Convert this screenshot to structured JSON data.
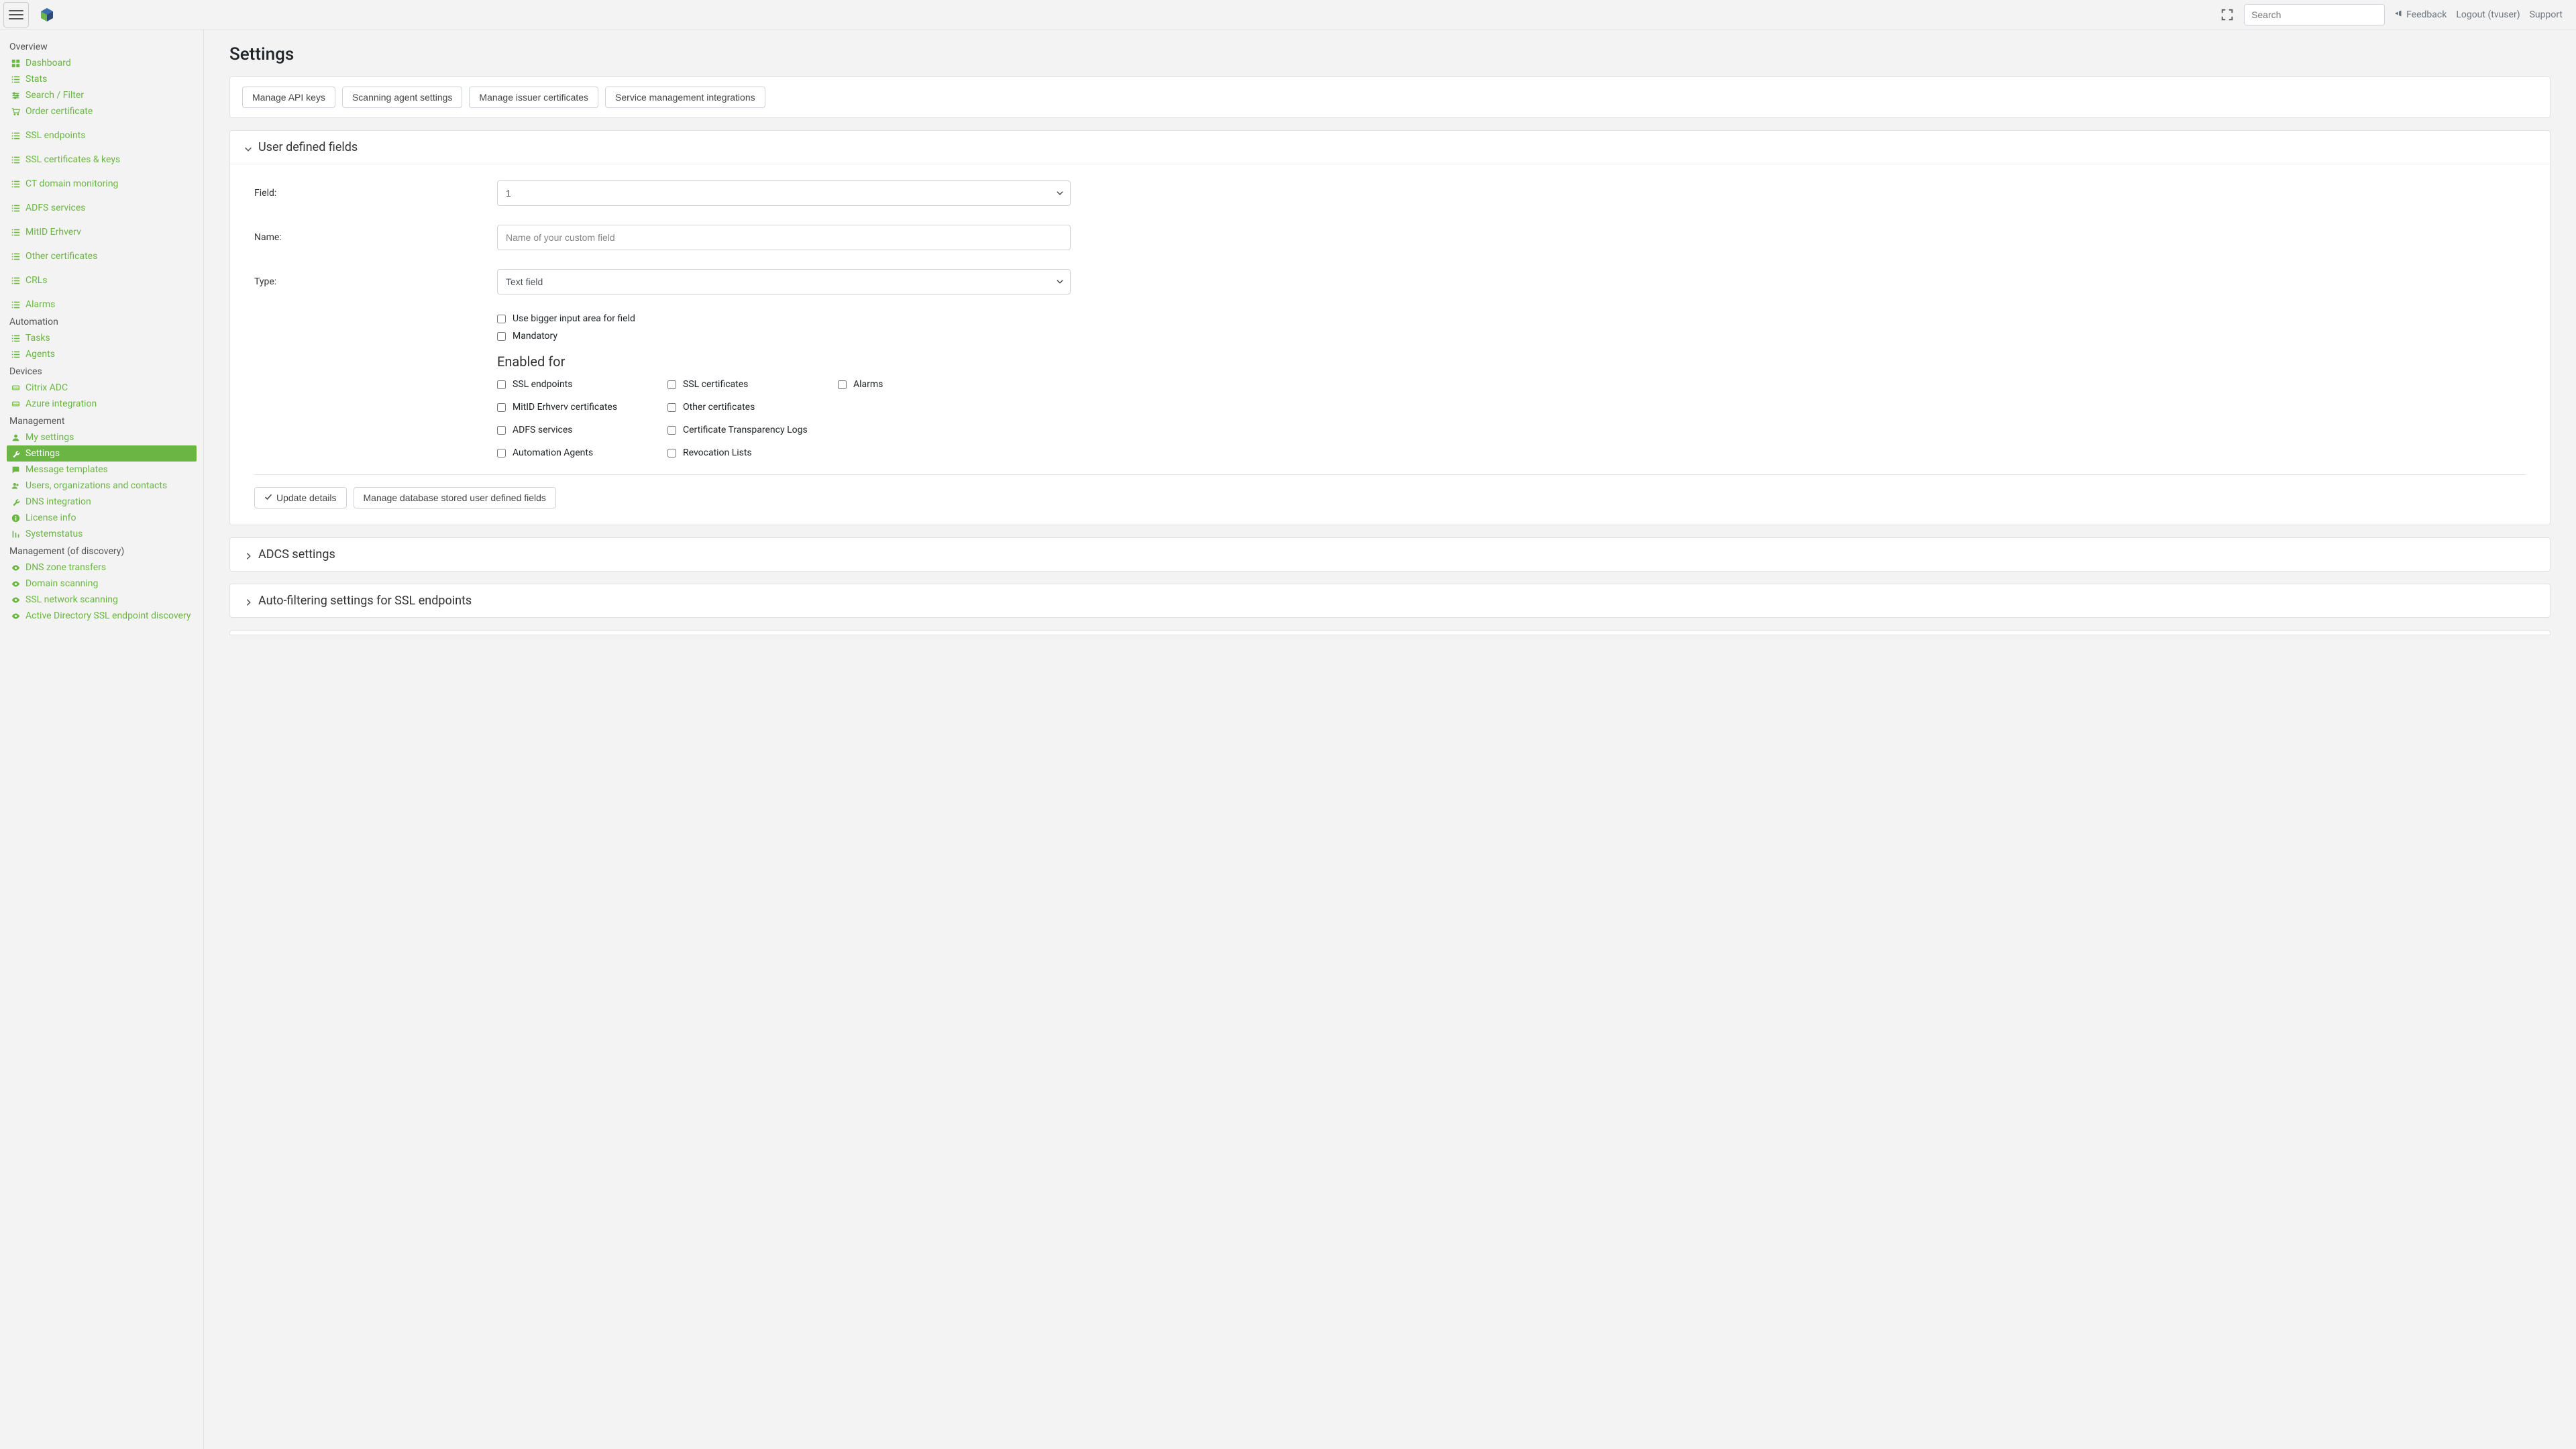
{
  "header": {
    "search_placeholder": "Search",
    "feedback_label": "Feedback",
    "logout_label": "Logout (tvuser)",
    "support_label": "Support"
  },
  "sidebar": {
    "sections": [
      {
        "heading": "Overview",
        "items": [
          {
            "icon": "grid",
            "label": "Dashboard"
          },
          {
            "icon": "list",
            "label": "Stats"
          },
          {
            "icon": "sliders",
            "label": "Search / Filter"
          },
          {
            "icon": "cart",
            "label": "Order certificate"
          }
        ]
      },
      {
        "heading": "",
        "items": [
          {
            "icon": "list",
            "label": "SSL endpoints"
          }
        ]
      },
      {
        "heading": "",
        "items": [
          {
            "icon": "list",
            "label": "SSL certificates & keys"
          }
        ]
      },
      {
        "heading": "",
        "items": [
          {
            "icon": "list",
            "label": "CT domain monitoring"
          }
        ]
      },
      {
        "heading": "",
        "items": [
          {
            "icon": "list",
            "label": "ADFS services"
          }
        ]
      },
      {
        "heading": "",
        "items": [
          {
            "icon": "list",
            "label": "MitID Erhverv"
          }
        ]
      },
      {
        "heading": "",
        "items": [
          {
            "icon": "list",
            "label": "Other certificates"
          }
        ]
      },
      {
        "heading": "",
        "items": [
          {
            "icon": "list",
            "label": "CRLs"
          }
        ]
      },
      {
        "heading": "",
        "items": [
          {
            "icon": "list",
            "label": "Alarms"
          }
        ]
      },
      {
        "heading": "Automation",
        "items": [
          {
            "icon": "list",
            "label": "Tasks"
          },
          {
            "icon": "list",
            "label": "Agents"
          }
        ]
      },
      {
        "heading": "Devices",
        "items": [
          {
            "icon": "device",
            "label": "Citrix ADC"
          },
          {
            "icon": "device",
            "label": "Azure integration"
          }
        ]
      },
      {
        "heading": "Management",
        "items": [
          {
            "icon": "user",
            "label": "My settings"
          },
          {
            "icon": "wrench",
            "label": "Settings",
            "active": true
          },
          {
            "icon": "message",
            "label": "Message templates"
          },
          {
            "icon": "users",
            "label": "Users, organizations and contacts"
          },
          {
            "icon": "wrench",
            "label": "DNS integration"
          },
          {
            "icon": "info",
            "label": "License info"
          },
          {
            "icon": "equalizer",
            "label": "Systemstatus"
          }
        ]
      },
      {
        "heading": "Management (of discovery)",
        "items": [
          {
            "icon": "eye",
            "label": "DNS zone transfers"
          },
          {
            "icon": "eye",
            "label": "Domain scanning"
          },
          {
            "icon": "eye",
            "label": "SSL network scanning"
          },
          {
            "icon": "eye",
            "label": "Active Directory SSL endpoint discovery"
          }
        ]
      }
    ]
  },
  "main": {
    "page_title": "Settings",
    "action_buttons": [
      "Manage API keys",
      "Scanning agent settings",
      "Manage issuer certificates",
      "Service management integrations"
    ],
    "panel_udf": {
      "title": "User defined fields",
      "field_label": "Field:",
      "field_value": "1",
      "name_label": "Name:",
      "name_placeholder": "Name of your custom field",
      "type_label": "Type:",
      "type_value": "Text field",
      "cb_bigger": "Use bigger input area for field",
      "cb_mandatory": "Mandatory",
      "enabled_heading": "Enabled for",
      "enabled_options": [
        "SSL endpoints",
        "SSL certificates",
        "Alarms",
        "MitID Erhverv certificates",
        "Other certificates",
        "",
        "ADFS services",
        "Certificate Transparency Logs",
        "",
        "Automation Agents",
        "Revocation Lists",
        ""
      ],
      "btn_update": "Update details",
      "btn_manage": "Manage database stored user defined fields"
    },
    "panel_adcs_title": "ADCS settings",
    "panel_autofilter_title": "Auto-filtering settings for SSL endpoints"
  }
}
